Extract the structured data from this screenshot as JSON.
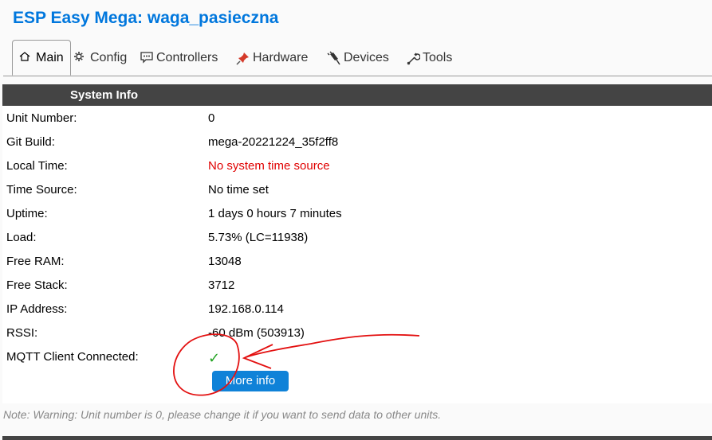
{
  "header": {
    "title": "ESP Easy Mega: waga_pasieczna"
  },
  "tabs": [
    {
      "label": "Main",
      "icon": "home-icon"
    },
    {
      "label": "Config",
      "icon": "gear-icon"
    },
    {
      "label": "Controllers",
      "icon": "chat-icon"
    },
    {
      "label": "Hardware",
      "icon": "pin-icon"
    },
    {
      "label": "Devices",
      "icon": "plug-icon"
    },
    {
      "label": "Tools",
      "icon": "wrench-icon"
    }
  ],
  "section": {
    "title": "System Info"
  },
  "rows": [
    {
      "label": "Unit Number:",
      "value": "0"
    },
    {
      "label": "Git Build:",
      "value": "mega-20221224_35f2ff8"
    },
    {
      "label": "Local Time:",
      "value": "No system time source"
    },
    {
      "label": "Time Source:",
      "value": "No time set"
    },
    {
      "label": "Uptime:",
      "value": "1 days 0 hours 7 minutes"
    },
    {
      "label": "Load:",
      "value": "5.73% (LC=11938)"
    },
    {
      "label": "Free RAM:",
      "value": "13048"
    },
    {
      "label": "Free Stack:",
      "value": "3712"
    },
    {
      "label": "IP Address:",
      "value": "192.168.0.114"
    },
    {
      "label": "RSSI:",
      "value": "-60 dBm (503913)"
    },
    {
      "label": "MQTT Client Connected:",
      "value": "✓"
    }
  ],
  "more_info_button": "More info",
  "note": "Note: Warning: Unit number is 0, please change it if you want to send data to other units.",
  "colors": {
    "title": "#0077dd",
    "section_bar": "#444444",
    "error_text": "#e00000",
    "check": "#22a322",
    "button": "#0f82d8",
    "annotation": "#e31010"
  }
}
